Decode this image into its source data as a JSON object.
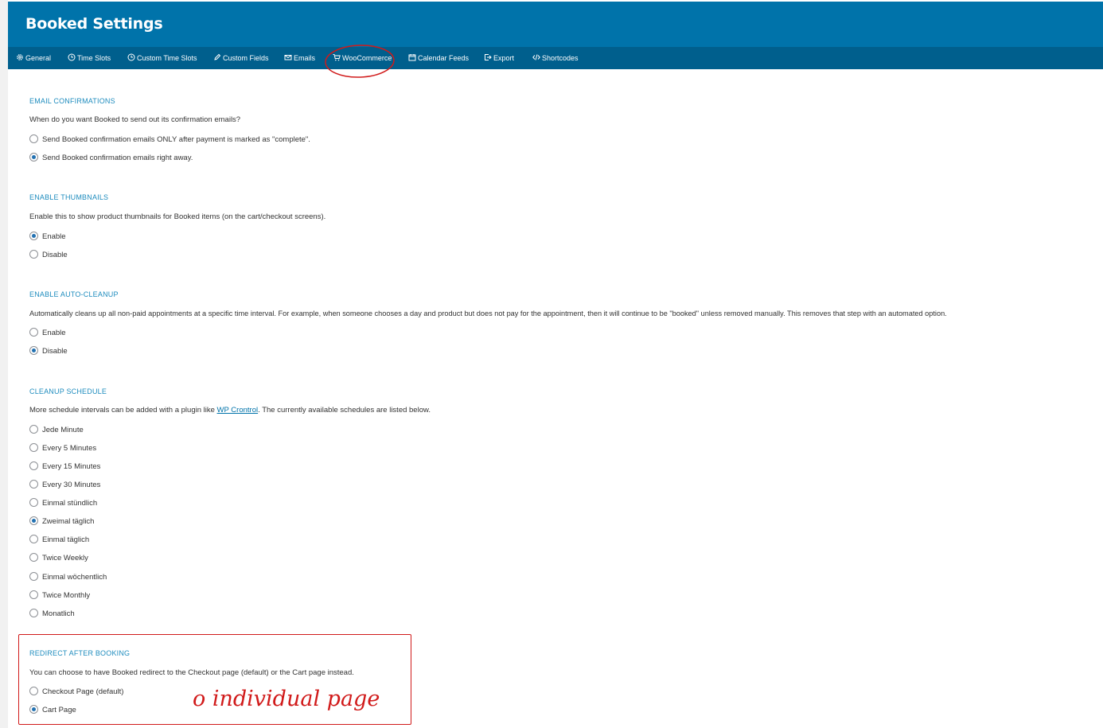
{
  "header": {
    "title": "Booked Settings"
  },
  "tabs": [
    {
      "label": "General",
      "icon": "gear-icon"
    },
    {
      "label": "Time Slots",
      "icon": "clock-icon"
    },
    {
      "label": "Custom Time Slots",
      "icon": "clock-icon"
    },
    {
      "label": "Custom Fields",
      "icon": "pencil-icon"
    },
    {
      "label": "Emails",
      "icon": "envelope-icon"
    },
    {
      "label": "WooCommerce",
      "icon": "cart-icon",
      "active": true
    },
    {
      "label": "Calendar Feeds",
      "icon": "calendar-icon"
    },
    {
      "label": "Export",
      "icon": "export-icon"
    },
    {
      "label": "Shortcodes",
      "icon": "code-icon"
    }
  ],
  "sections": {
    "email_confirmations": {
      "title": "EMAIL CONFIRMATIONS",
      "description": "When do you want Booked to send out its confirmation emails?",
      "options": [
        {
          "label": "Send Booked confirmation emails ONLY after payment is marked as \"complete\".",
          "checked": false
        },
        {
          "label": "Send Booked confirmation emails right away.",
          "checked": true
        }
      ]
    },
    "enable_thumbnails": {
      "title": "ENABLE THUMBNAILS",
      "description": "Enable this to show product thumbnails for Booked items (on the cart/checkout screens).",
      "options": [
        {
          "label": "Enable",
          "checked": true
        },
        {
          "label": "Disable",
          "checked": false
        }
      ]
    },
    "auto_cleanup": {
      "title": "ENABLE AUTO-CLEANUP",
      "description": "Automatically cleans up all non-paid appointments at a specific time interval. For example, when someone chooses a day and product but does not pay for the appointment, then it will continue to be \"booked\" unless removed manually. This removes that step with an automated option.",
      "options": [
        {
          "label": "Enable",
          "checked": false
        },
        {
          "label": "Disable",
          "checked": true
        }
      ]
    },
    "cleanup_schedule": {
      "title": "CLEANUP SCHEDULE",
      "description_before": "More schedule intervals can be added with a plugin like ",
      "description_link": "WP Crontrol",
      "description_after": ". The currently available schedules are listed below.",
      "options": [
        {
          "label": "Jede Minute",
          "checked": false
        },
        {
          "label": "Every 5 Minutes",
          "checked": false
        },
        {
          "label": "Every 15 Minutes",
          "checked": false
        },
        {
          "label": "Every 30 Minutes",
          "checked": false
        },
        {
          "label": "Einmal stündlich",
          "checked": false
        },
        {
          "label": "Zweimal täglich",
          "checked": true
        },
        {
          "label": "Einmal täglich",
          "checked": false
        },
        {
          "label": "Twice Weekly",
          "checked": false
        },
        {
          "label": "Einmal wöchentlich",
          "checked": false
        },
        {
          "label": "Twice Monthly",
          "checked": false
        },
        {
          "label": "Monatlich",
          "checked": false
        }
      ]
    },
    "redirect_after_booking": {
      "title": "REDIRECT AFTER BOOKING",
      "description": "You can choose to have Booked redirect to the Checkout page (default) or the Cart page instead.",
      "options": [
        {
          "label": "Checkout Page (default)",
          "checked": false
        },
        {
          "label": "Cart Page",
          "checked": true
        }
      ]
    }
  },
  "annotation": {
    "handwritten_note": "o individual page",
    "color": "#d11a1a"
  },
  "colors": {
    "header_bg": "#0073aa",
    "tabs_bg": "#005f8d",
    "section_title": "#1e8cbe",
    "radio_checked": "#2271b1"
  }
}
